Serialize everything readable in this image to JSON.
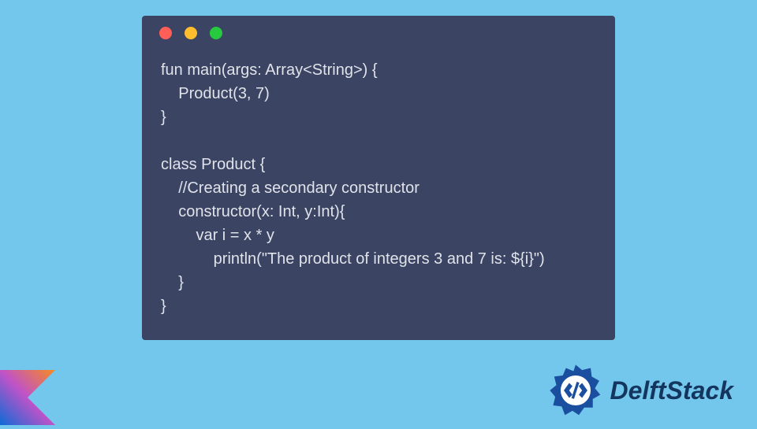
{
  "window": {
    "dots": {
      "red": "#ff5f56",
      "yellow": "#ffbd2e",
      "green": "#27c93f"
    }
  },
  "code": "fun main(args: Array<String>) {\n    Product(3, 7)\n}\n\nclass Product {\n    //Creating a secondary constructor\n    constructor(x: Int, y:Int){\n        var i = x * y\n            println(\"The product of integers 3 and 7 is: ${i}\")\n    }\n}",
  "brand": {
    "name": "DelftStack",
    "logo_color": "#1a4fa0"
  },
  "kotlin_badge": {
    "name": "kotlin-logo"
  }
}
